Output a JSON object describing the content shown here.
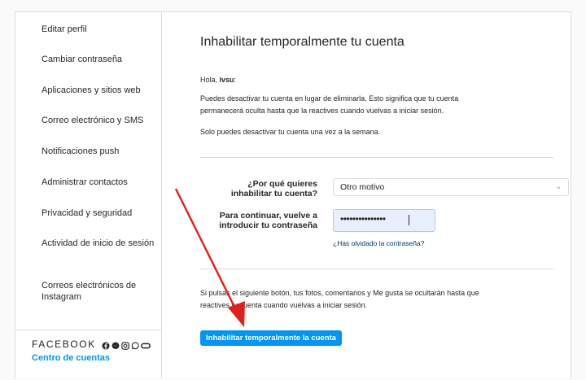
{
  "sidebar": {
    "items": [
      {
        "label": "Editar perfil"
      },
      {
        "label": "Cambiar contraseña"
      },
      {
        "label": "Aplicaciones y sitios web"
      },
      {
        "label": "Correo electrónico y SMS"
      },
      {
        "label": "Notificaciones push"
      },
      {
        "label": "Administrar contactos"
      },
      {
        "label": "Privacidad y seguridad"
      },
      {
        "label": "Actividad de inicio de sesión"
      },
      {
        "label": "Correos electrónicos de Instagram"
      }
    ],
    "facebook_label": "FACEBOOK",
    "accounts_center_link": "Centro de cuentas",
    "facebook_icons": [
      "facebook-icon",
      "messenger-icon",
      "instagram-icon",
      "whatsapp-icon",
      "oculus-icon"
    ]
  },
  "main": {
    "title": "Inhabilitar temporalmente tu cuenta",
    "greeting_prefix": "Hola, ",
    "username": "ivsu",
    "greeting_suffix": ":",
    "para1_line1": "Puedes desactivar tu cuenta en lugar de eliminarla. Esto significa que tu cuenta",
    "para1_line2": "permanecerá oculta hasta que la reactives cuando vuelvas a iniciar sesión.",
    "para2": "Solo puedes desactivar tu cuenta una vez a la semana.",
    "reason_label_line1": "¿Por qué quieres",
    "reason_label_line2": "inhabilitar tu cuenta?",
    "reason_selected": "Otro motivo",
    "password_label_line1": "Para continuar, vuelve a",
    "password_label_line2": "introducir tu contraseña",
    "password_value": "•••••••••••••••",
    "forgot_link": "¿Has olvidado la contraseña?",
    "warning_line1": "Si pulsas el siguiente botón, tus fotos, comentarios y Me gusta se ocultarán hasta que",
    "warning_line2": "reactives tu cuenta cuando vuelvas a iniciar sesión.",
    "disable_button": "Inhabilitar temporalmente la cuenta"
  },
  "colors": {
    "accent": "#0095f6",
    "annotation_arrow": "#e0201b"
  }
}
